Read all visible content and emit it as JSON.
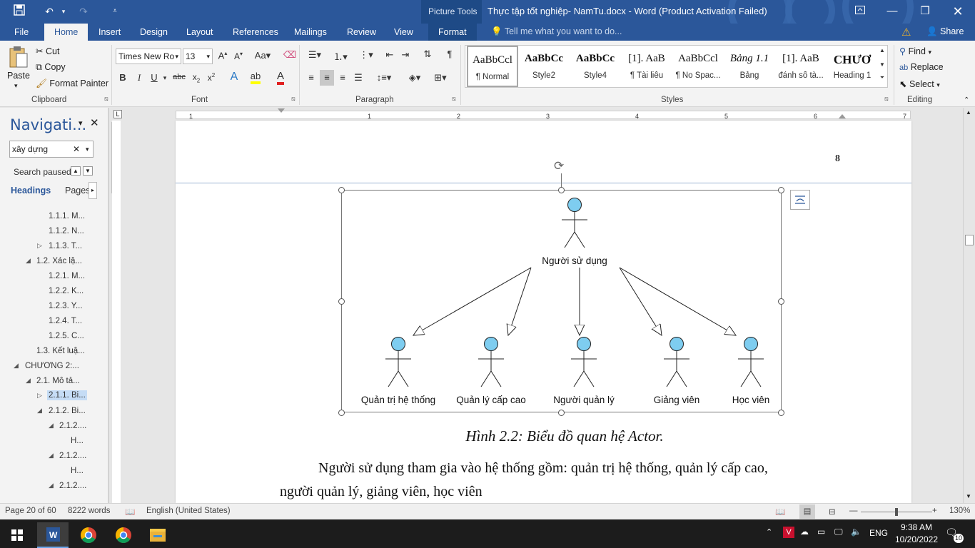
{
  "titlebar": {
    "context_tab": "Picture Tools",
    "doc_title": "Thực tập tốt nghiệp- NamTu.docx - Word (Product Activation Failed)"
  },
  "tabs": {
    "file": "File",
    "home": "Home",
    "insert": "Insert",
    "design": "Design",
    "layout": "Layout",
    "references": "References",
    "mailings": "Mailings",
    "review": "Review",
    "view": "View",
    "format": "Format",
    "tell_me": "Tell me what you want to do...",
    "share": "Share"
  },
  "clipboard": {
    "paste": "Paste",
    "cut": "Cut",
    "copy": "Copy",
    "format_painter": "Format Painter",
    "label": "Clipboard"
  },
  "font": {
    "name": "Times New Ro",
    "size": "13",
    "label": "Font"
  },
  "paragraph": {
    "label": "Paragraph"
  },
  "styles": {
    "label": "Styles",
    "items": [
      {
        "sample": "AaBbCcl",
        "name": "¶ Normal"
      },
      {
        "sample": "AaBbCc",
        "name": "Style2"
      },
      {
        "sample": "AaBbCc",
        "name": "Style4"
      },
      {
        "sample": "[1].  AaB",
        "name": "¶ Tài liêu"
      },
      {
        "sample": "AaBbCcl",
        "name": "¶ No Spac..."
      },
      {
        "sample": "Bảng 1.1",
        "name": "Bảng"
      },
      {
        "sample": "[1].  AaB",
        "name": "đánh số tà..."
      },
      {
        "sample": "CHƯƠ",
        "name": "Heading 1"
      }
    ]
  },
  "editing": {
    "find": "Find",
    "replace": "Replace",
    "select": "Select",
    "label": "Editing"
  },
  "nav": {
    "title": "Navigati...",
    "search": "xây dựng",
    "search_status": "Search paused",
    "tab_headings": "Headings",
    "tab_pages": "Pages",
    "items": [
      "1.1.1. M...",
      "1.1.2. N...",
      "1.1.3. T...",
      "1.2. Xác lậ...",
      "1.2.1. M...",
      "1.2.2. K...",
      "1.2.3. Y...",
      "1.2.4. T...",
      "1.2.5. C...",
      "1.3. Kết luậ...",
      "CHƯƠNG 2:...",
      "2.1. Mô tả...",
      "2.1.1. Bi...",
      "2.1.2. Bi...",
      "2.1.2....",
      "H...",
      "2.1.2....",
      "H...",
      "2.1.2...."
    ]
  },
  "ruler": {
    "ticks": [
      "1",
      "1",
      "2",
      "3",
      "4",
      "5",
      "6",
      "7"
    ]
  },
  "page": {
    "page_number": "8",
    "diagram": {
      "root": "Người sử dụng",
      "actors": [
        "Quản trị hệ thống",
        "Quản lý cấp cao",
        "Người quản lý",
        "Giảng viên",
        "Học viên"
      ]
    },
    "caption": "Hình 2.2: Biểu đồ quan hệ Actor.",
    "body_line1": "Người sử dụng tham gia vào hệ thống gồm: quản trị hệ thống, quản lý cấp cao,",
    "body_line2": "người quản lý, giảng viên, học viên"
  },
  "status": {
    "page": "Page 20 of 60",
    "words": "8222 words",
    "language": "English (United States)",
    "zoom": "130%"
  },
  "taskbar": {
    "language": "ENG",
    "time": "9:38 AM",
    "date": "10/20/2022",
    "notifications": "10"
  },
  "colors": {
    "word_blue": "#2b579a",
    "actor_fill": "#7ecdf0",
    "selected_nav": "#c5dcf5"
  }
}
